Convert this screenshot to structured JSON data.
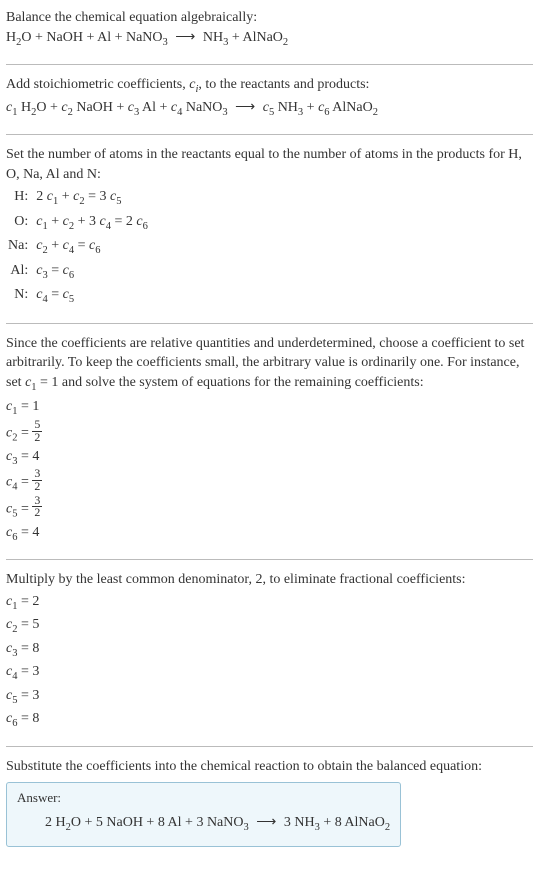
{
  "section1": {
    "line1": "Balance the chemical equation algebraically:",
    "eq_parts": {
      "H2O": "H",
      "H2O_sub": "2",
      "H2O_O": "O",
      "plus1": " + ",
      "NaOH": "NaOH",
      "plus2": " + ",
      "Al": "Al",
      "plus3": " + ",
      "NaNO3_Na": "NaNO",
      "NaNO3_sub": "3",
      "arrow": "⟶",
      "NH3_N": "NH",
      "NH3_sub": "3",
      "plus4": " + ",
      "AlNaO2": "AlNaO",
      "AlNaO2_sub": "2"
    }
  },
  "section2": {
    "line1_a": "Add stoichiometric coefficients, ",
    "line1_ci": "c",
    "line1_ci_sub": "i",
    "line1_b": ", to the reactants and products:",
    "c1": "c",
    "s1": "1",
    "sp1": " H",
    "sp1sub": "2",
    "sp1b": "O + ",
    "c2": "c",
    "s2": "2",
    "sp2": " NaOH + ",
    "c3": "c",
    "s3": "3",
    "sp3": " Al + ",
    "c4": "c",
    "s4": "4",
    "sp4": " NaNO",
    "sp4sub": "3",
    "arrow": "⟶",
    "c5": "c",
    "s5": "5",
    "sp5": " NH",
    "sp5sub": "3",
    "sp5b": " + ",
    "c6": "c",
    "s6": "6",
    "sp6": " AlNaO",
    "sp6sub": "2"
  },
  "section3": {
    "line1": "Set the number of atoms in the reactants equal to the number of atoms in the products for H, O, Na, Al and N:",
    "rows": [
      {
        "label": "H:",
        "eq_pre": "2 ",
        "c_a": "c",
        "s_a": "1",
        "mid": " + ",
        "c_b": "c",
        "s_b": "2",
        "rhs": " = 3 ",
        "c_r": "c",
        "s_r": "5"
      },
      {
        "label": "O:",
        "c_a": "c",
        "s_a": "1",
        "mid1": " + ",
        "c_b": "c",
        "s_b": "2",
        "mid2": " + 3 ",
        "c_c": "c",
        "s_c": "4",
        "rhs": " = 2 ",
        "c_r": "c",
        "s_r": "6"
      },
      {
        "label": "Na:",
        "c_a": "c",
        "s_a": "2",
        "mid": " + ",
        "c_b": "c",
        "s_b": "4",
        "rhs": " = ",
        "c_r": "c",
        "s_r": "6"
      },
      {
        "label": "Al:",
        "c_a": "c",
        "s_a": "3",
        "rhs": " = ",
        "c_r": "c",
        "s_r": "6"
      },
      {
        "label": "N:",
        "c_a": "c",
        "s_a": "4",
        "rhs": " = ",
        "c_r": "c",
        "s_r": "5"
      }
    ]
  },
  "section4": {
    "line1_a": "Since the coefficients are relative quantities and underdetermined, choose a coefficient to set arbitrarily. To keep the coefficients small, the arbitrary value is ordinarily one. For instance, set ",
    "line1_c": "c",
    "line1_s": "1",
    "line1_b": " = 1 and solve the system of equations for the remaining coefficients:",
    "c1l": "c",
    "c1s": "1",
    "c1v": " = 1",
    "c2l": "c",
    "c2s": "2",
    "c2eq": " = ",
    "c2num": "5",
    "c2den": "2",
    "c3l": "c",
    "c3s": "3",
    "c3v": " = 4",
    "c4l": "c",
    "c4s": "4",
    "c4eq": " = ",
    "c4num": "3",
    "c4den": "2",
    "c5l": "c",
    "c5s": "5",
    "c5eq": " = ",
    "c5num": "3",
    "c5den": "2",
    "c6l": "c",
    "c6s": "6",
    "c6v": " = 4"
  },
  "section5": {
    "line1": "Multiply by the least common denominator, 2, to eliminate fractional coefficients:",
    "rows": [
      {
        "c": "c",
        "s": "1",
        "v": " = 2"
      },
      {
        "c": "c",
        "s": "2",
        "v": " = 5"
      },
      {
        "c": "c",
        "s": "3",
        "v": " = 8"
      },
      {
        "c": "c",
        "s": "4",
        "v": " = 3"
      },
      {
        "c": "c",
        "s": "5",
        "v": " = 3"
      },
      {
        "c": "c",
        "s": "6",
        "v": " = 8"
      }
    ]
  },
  "section6": {
    "line1": "Substitute the coefficients into the chemical reaction to obtain the balanced equation:",
    "answer_label": "Answer:",
    "eq": {
      "p1": "2 H",
      "p1s": "2",
      "p1b": "O + 5 NaOH + 8 Al + 3 NaNO",
      "p1s2": "3",
      "arrow": "⟶",
      "p2": "3 NH",
      "p2s": "3",
      "p2b": " + 8 AlNaO",
      "p2s2": "2"
    }
  }
}
